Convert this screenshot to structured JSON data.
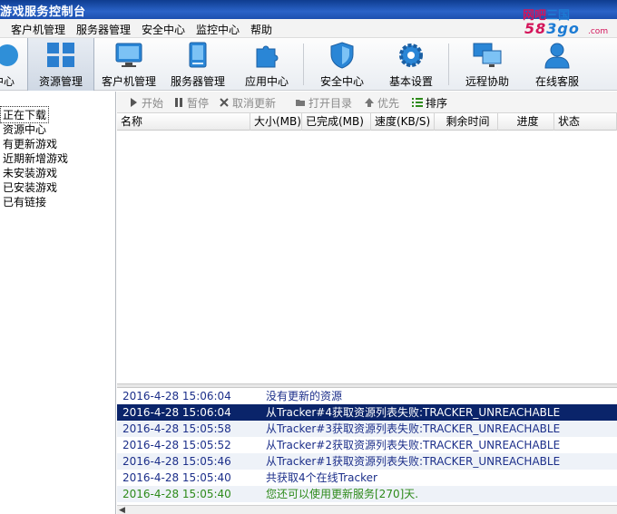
{
  "window": {
    "title": "游戏服务控制台"
  },
  "watermark": {
    "line1_a": "网吧",
    "line1_b": "三国",
    "line2_a": "58",
    "line2_b": "3go",
    "line3": ".com"
  },
  "menu": [
    "客户机管理",
    "服务器管理",
    "安全中心",
    "监控中心",
    "帮助"
  ],
  "toolbar": [
    {
      "label": "中心",
      "icon": "partial-icon"
    },
    {
      "label": "资源管理",
      "icon": "grid-icon",
      "active": true
    },
    {
      "label": "客户机管理",
      "icon": "monitor-icon"
    },
    {
      "label": "服务器管理",
      "icon": "server-icon"
    },
    {
      "label": "应用中心",
      "icon": "puzzle-icon"
    },
    {
      "label": "安全中心",
      "icon": "shield-icon"
    },
    {
      "label": "基本设置",
      "icon": "gear-icon"
    },
    {
      "label": "远程协助",
      "icon": "remote-screens-icon"
    },
    {
      "label": "在线客服",
      "icon": "user-support-icon"
    }
  ],
  "tree": [
    "正在下载",
    "资源中心",
    "有更新游戏",
    "近期新增游戏",
    "未安装游戏",
    "已安装游戏",
    "已有链接"
  ],
  "actions": {
    "start": "开始",
    "pause": "暂停",
    "cancel_update": "取消更新",
    "open_dir": "打开目录",
    "priority": "优先",
    "sort": "排序"
  },
  "columns": [
    "名称",
    "大小(MB)",
    "已完成(MB)",
    "速度(KB/S)",
    "剩余时间",
    "进度",
    "状态"
  ],
  "log": [
    {
      "time": "2016-4-28 15:06:04",
      "msg": "没有更新的资源",
      "style": "blue"
    },
    {
      "time": "2016-4-28 15:06:04",
      "msg": "从Tracker#4获取资源列表失败:TRACKER_UNREACHABLE",
      "style": "sel"
    },
    {
      "time": "2016-4-28 15:05:58",
      "msg": "从Tracker#3获取资源列表失败:TRACKER_UNREACHABLE",
      "style": "blue alt"
    },
    {
      "time": "2016-4-28 15:05:52",
      "msg": "从Tracker#2获取资源列表失败:TRACKER_UNREACHABLE",
      "style": "blue"
    },
    {
      "time": "2016-4-28 15:05:46",
      "msg": "从Tracker#1获取资源列表失败:TRACKER_UNREACHABLE",
      "style": "blue alt"
    },
    {
      "time": "2016-4-28 15:05:40",
      "msg": "共获取4个在线Tracker",
      "style": "blue"
    },
    {
      "time": "2016-4-28 15:05:40",
      "msg": "您还可以使用更新服务[270]天.",
      "style": "green alt"
    }
  ],
  "colors": {
    "titlebar": "#1c4fae",
    "selection": "#0a246a",
    "log_text": "#1c2f8a",
    "log_green": "#2d8a1a"
  }
}
